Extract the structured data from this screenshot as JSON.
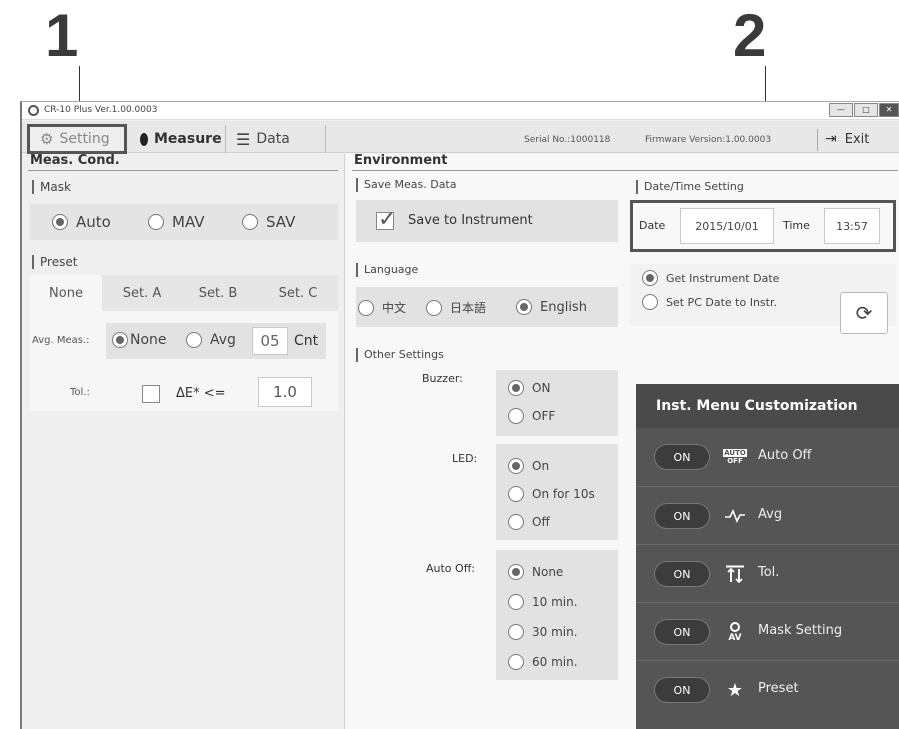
{
  "callouts": {
    "one": "1",
    "two": "2"
  },
  "window": {
    "title": "CR-10 Plus Ver.1.00.0003",
    "controls": {
      "minimize": "—",
      "maximize": "□",
      "close": "✕"
    }
  },
  "tabs": {
    "setting": "Setting",
    "measure": "Measure",
    "data": "Data"
  },
  "header_info": {
    "serial": "Serial No.:1000118",
    "firmware": "Firmware Version:1.00.0003",
    "exit": "Exit"
  },
  "meas_cond": {
    "title": "Meas. Cond.",
    "mask": {
      "label": "Mask",
      "options": [
        "Auto",
        "MAV",
        "SAV"
      ],
      "selected": "Auto"
    },
    "preset": {
      "label": "Preset",
      "tabs": [
        "None",
        "Set. A",
        "Set. B",
        "Set. C"
      ],
      "selected": "None"
    },
    "avg_meas": {
      "label": "Avg. Meas.:",
      "options": [
        "None",
        "Avg"
      ],
      "selected": "None",
      "count": "05",
      "unit": "Cnt"
    },
    "tol": {
      "label": "Tol.:",
      "text": "ΔE* <=",
      "value": "1.0",
      "checked": false
    }
  },
  "environment": {
    "title": "Environment",
    "save_meas": {
      "label": "Save Meas. Data",
      "checkbox_label": "Save to Instrument",
      "checked": true
    },
    "language": {
      "label": "Language",
      "options": [
        "中文",
        "日本語",
        "English"
      ],
      "selected": "English"
    },
    "other": {
      "label": "Other Settings",
      "buzzer": {
        "label": "Buzzer:",
        "options": [
          "ON",
          "OFF"
        ],
        "selected": "ON"
      },
      "led": {
        "label": "LED:",
        "options": [
          "On",
          "On for 10s",
          "Off"
        ],
        "selected": "On"
      },
      "auto_off": {
        "label": "Auto Off:",
        "options": [
          "None",
          "10 min.",
          "30 min.",
          "60 min."
        ],
        "selected": "None"
      }
    }
  },
  "datetime": {
    "label": "Date/Time Setting",
    "date_label": "Date",
    "date_value": "2015/10/01",
    "time_label": "Time",
    "time_value": "13:57",
    "options": [
      "Get Instrument Date",
      "Set PC Date to Instr."
    ],
    "selected": "Get Instrument Date"
  },
  "customization": {
    "title": "Inst. Menu Customization",
    "items": [
      {
        "state": "ON",
        "icon": "auto-off-icon",
        "icon_text": "AUTO OFF",
        "label": "Auto Off"
      },
      {
        "state": "ON",
        "icon": "avg-icon",
        "icon_text": "-⁄\\/-",
        "label": "Avg"
      },
      {
        "state": "ON",
        "icon": "tol-icon",
        "icon_text": "⇅",
        "label": "Tol."
      },
      {
        "state": "ON",
        "icon": "mask-icon",
        "icon_text": "AV",
        "label": "Mask Setting"
      },
      {
        "state": "ON",
        "icon": "star-icon",
        "icon_text": "★",
        "label": "Preset"
      }
    ]
  }
}
